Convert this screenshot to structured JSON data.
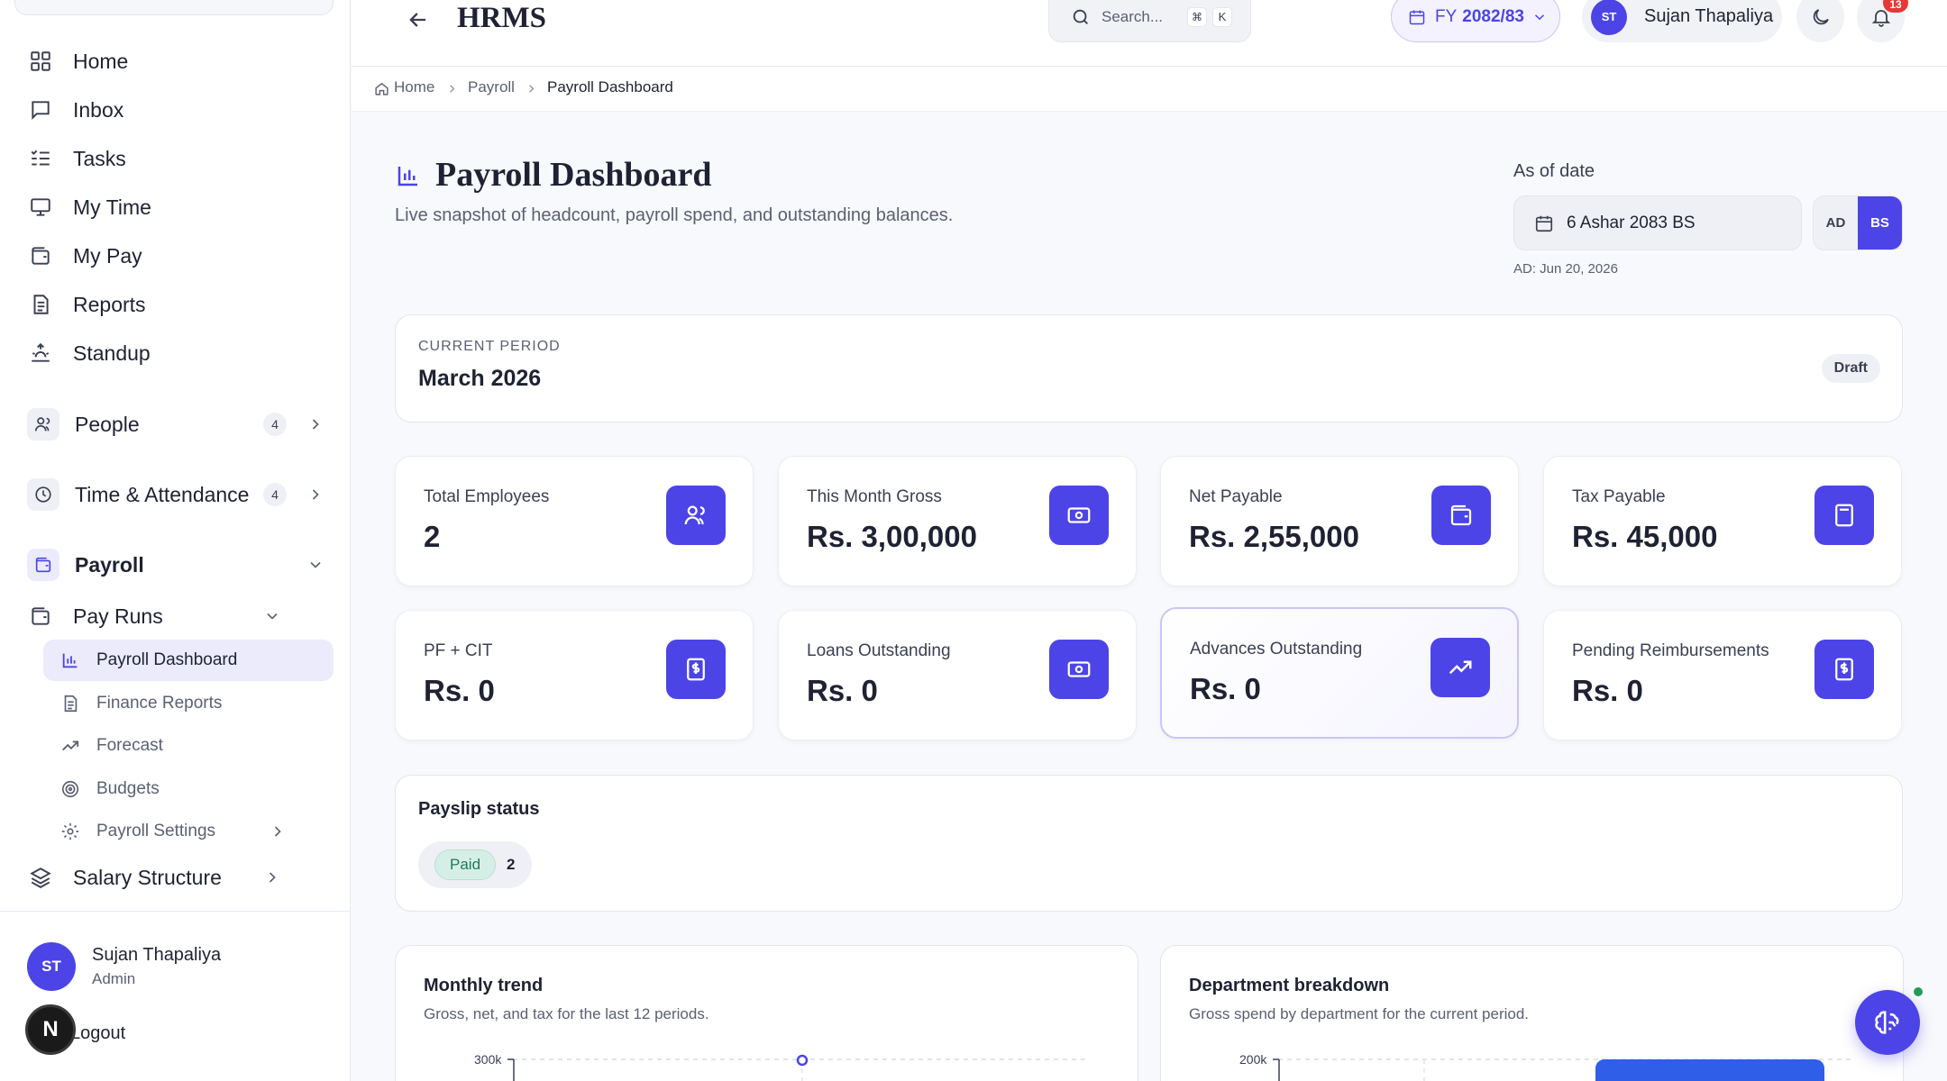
{
  "sidebar": {
    "nav": [
      {
        "label": "Home",
        "icon": "grid-icon"
      },
      {
        "label": "Inbox",
        "icon": "message-icon"
      },
      {
        "label": "Tasks",
        "icon": "tasks-icon"
      },
      {
        "label": "My Time",
        "icon": "monitor-icon"
      },
      {
        "label": "My Pay",
        "icon": "wallet-icon"
      },
      {
        "label": "Reports",
        "icon": "document-icon"
      },
      {
        "label": "Standup",
        "icon": "sunrise-icon"
      }
    ],
    "people": {
      "label": "People",
      "count": "4"
    },
    "time_attendance": {
      "label": "Time & Attendance",
      "count": "4"
    },
    "payroll": {
      "label": "Payroll"
    },
    "pay_runs": {
      "label": "Pay Runs"
    },
    "sub_items": [
      {
        "label": "Payroll Dashboard",
        "active": true
      },
      {
        "label": "Finance Reports"
      },
      {
        "label": "Forecast"
      },
      {
        "label": "Budgets"
      },
      {
        "label": "Payroll Settings"
      }
    ],
    "salary_structure": {
      "label": "Salary Structure"
    },
    "user": {
      "initials": "ST",
      "name": "Sujan Thapaliya",
      "role": "Admin"
    },
    "logout": "Logout",
    "next_badge": "N"
  },
  "header": {
    "app_title": "HRMS",
    "search_placeholder": "Search...",
    "shortcut_mod": "⌘",
    "shortcut_key": "K",
    "fiscal_year_prefix": "FY",
    "fiscal_year": "2082/83",
    "user_initials": "ST",
    "user_name": "Sujan Thapaliya",
    "notification_count": "13"
  },
  "breadcrumb": {
    "home": "Home",
    "section": "Payroll",
    "current": "Payroll Dashboard"
  },
  "page": {
    "title": "Payroll Dashboard",
    "subtitle": "Live snapshot of headcount, payroll spend, and outstanding balances.",
    "as_of_label": "As of date",
    "as_of_value": "6 Ashar 2083 BS",
    "toggle_ad": "AD",
    "toggle_bs": "BS",
    "ad_equivalent": "AD: Jun 20, 2026"
  },
  "period": {
    "label": "CURRENT PERIOD",
    "value": "March 2026",
    "status": "Draft"
  },
  "stats": [
    {
      "label": "Total Employees",
      "value": "2",
      "icon": "users-icon"
    },
    {
      "label": "This Month Gross",
      "value": "Rs. 3,00,000",
      "icon": "cash-icon"
    },
    {
      "label": "Net Payable",
      "value": "Rs. 2,55,000",
      "icon": "wallet-icon"
    },
    {
      "label": "Tax Payable",
      "value": "Rs. 45,000",
      "icon": "calculator-icon"
    },
    {
      "label": "PF + CIT",
      "value": "Rs. 0",
      "icon": "receipt-icon"
    },
    {
      "label": "Loans Outstanding",
      "value": "Rs. 0",
      "icon": "cash-icon"
    },
    {
      "label": "Advances Outstanding",
      "value": "Rs. 0",
      "icon": "trending-up-icon"
    },
    {
      "label": "Pending Reimbursements",
      "value": "Rs. 0",
      "icon": "receipt-icon"
    }
  ],
  "payslip": {
    "title": "Payslip status",
    "status": "Paid",
    "count": "2"
  },
  "trend": {
    "title": "Monthly trend",
    "subtitle": "Gross, net, and tax for the last 12 periods.",
    "y_tick_top": "300k"
  },
  "department": {
    "title": "Department breakdown",
    "subtitle": "Gross spend by department for the current period.",
    "y_tick_top": "200k"
  },
  "colors": {
    "accent": "#4c44e6",
    "accent_soft": "#ecebfc",
    "paid_bg": "#d6efe6",
    "paid_text": "#1f7a5a",
    "notify": "#e53935",
    "online": "#1f9d55"
  }
}
